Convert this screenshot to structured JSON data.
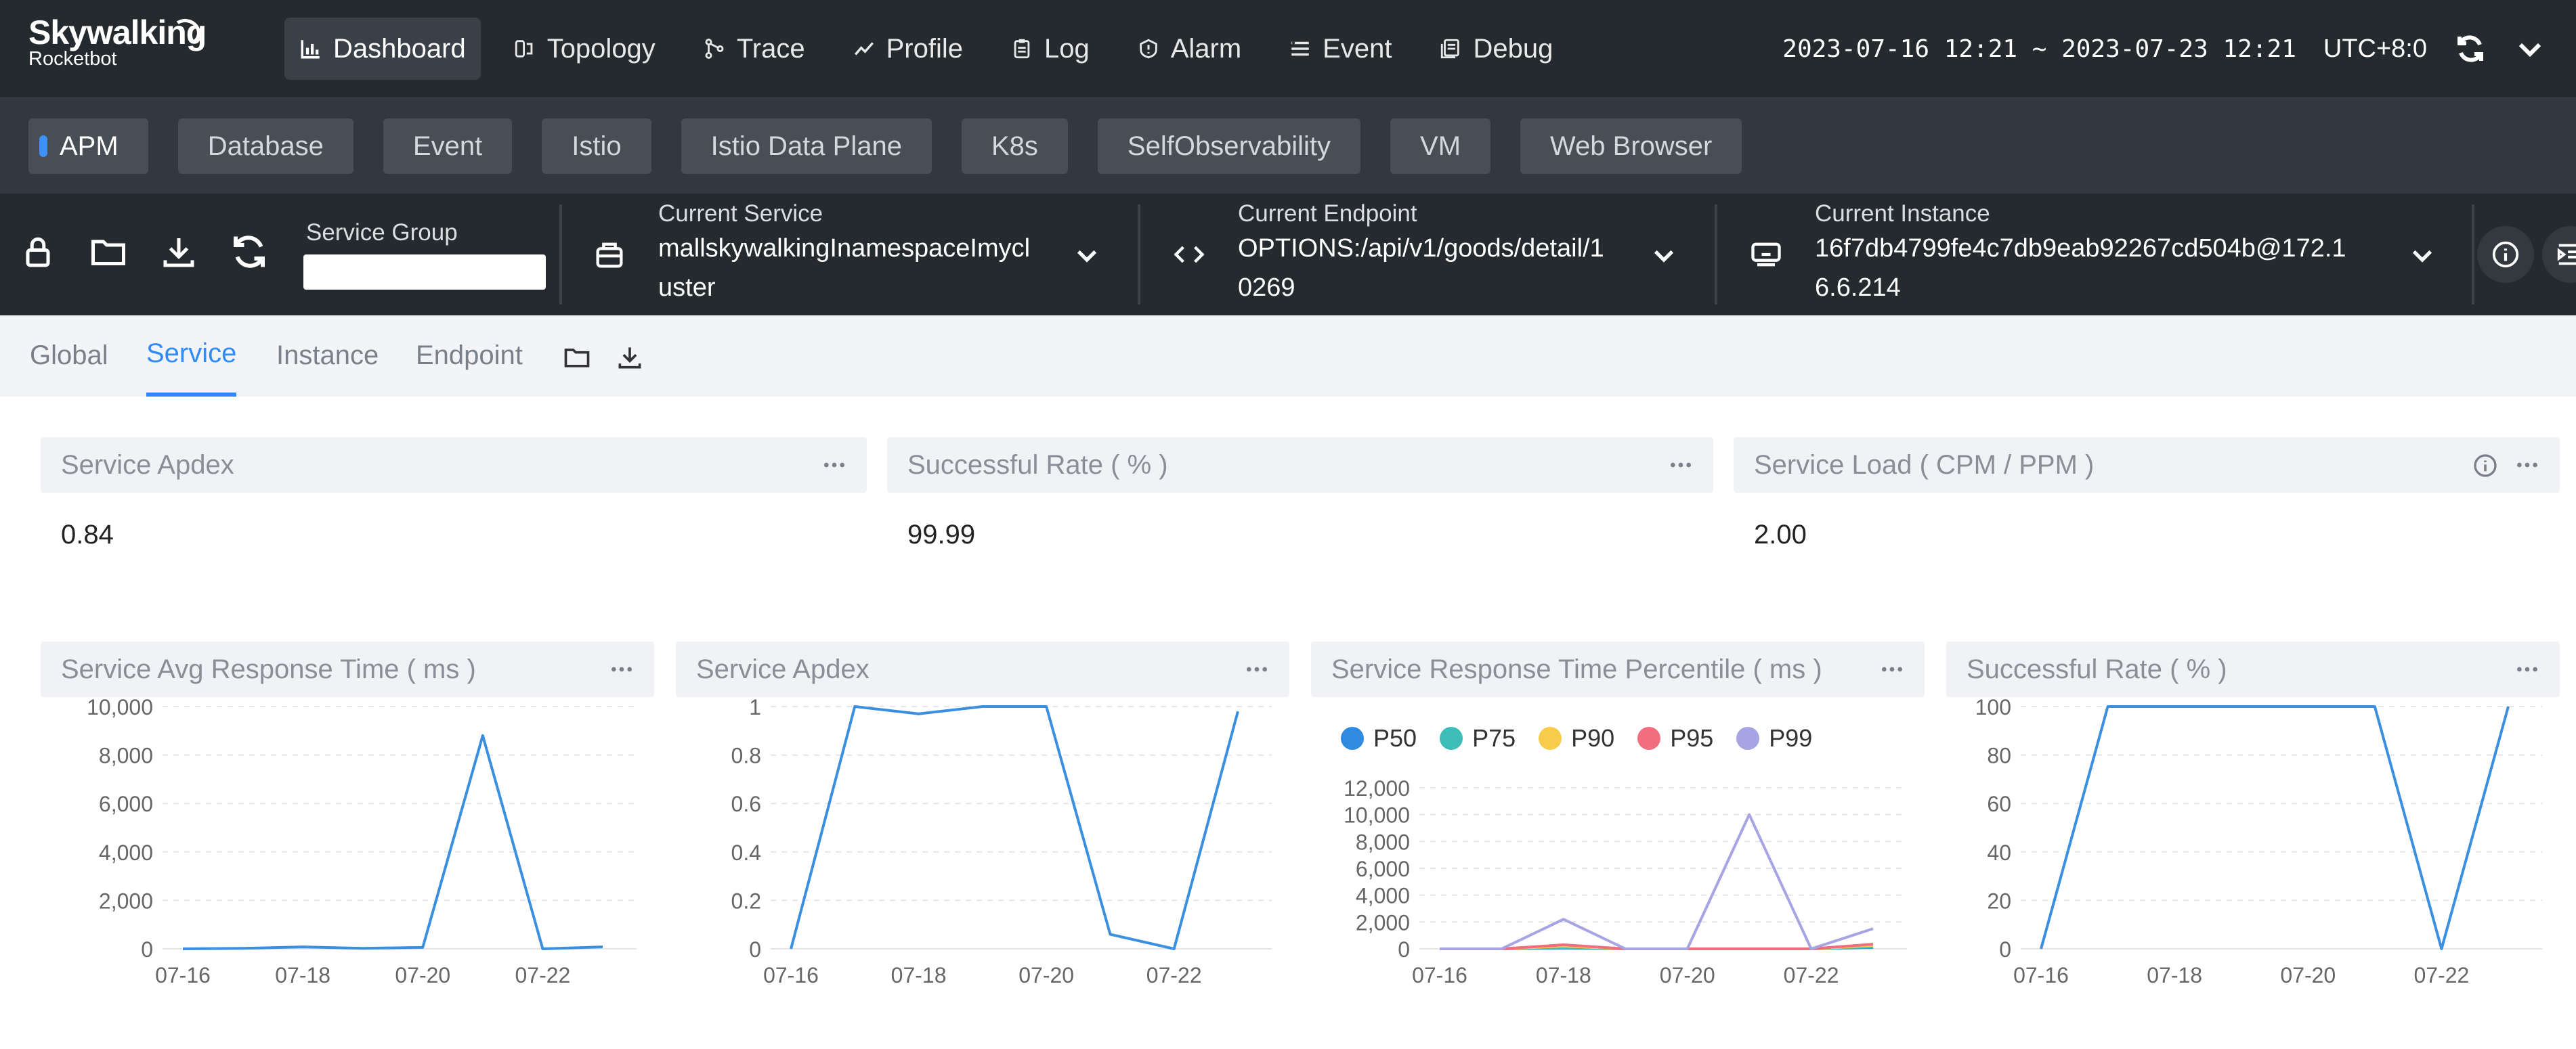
{
  "app": {
    "brand": "Skywalking",
    "subtitle": "Rocketbot"
  },
  "nav": [
    {
      "label": "Dashboard",
      "icon": "bar-chart-icon",
      "active": true
    },
    {
      "label": "Topology",
      "icon": "topology-icon",
      "active": false
    },
    {
      "label": "Trace",
      "icon": "trace-icon",
      "active": false
    },
    {
      "label": "Profile",
      "icon": "profile-icon",
      "active": false
    },
    {
      "label": "Log",
      "icon": "log-icon",
      "active": false
    },
    {
      "label": "Alarm",
      "icon": "alarm-icon",
      "active": false
    },
    {
      "label": "Event",
      "icon": "event-icon",
      "active": false
    },
    {
      "label": "Debug",
      "icon": "debug-icon",
      "active": false
    }
  ],
  "time": {
    "range": "2023-07-16 12:21 ~ 2023-07-23 12:21",
    "timezone": "UTC+8:0"
  },
  "layers": [
    {
      "label": "APM",
      "active": true
    },
    {
      "label": "Database",
      "active": false
    },
    {
      "label": "Event",
      "active": false
    },
    {
      "label": "Istio",
      "active": false
    },
    {
      "label": "Istio Data Plane",
      "active": false
    },
    {
      "label": "K8s",
      "active": false
    },
    {
      "label": "SelfObservability",
      "active": false
    },
    {
      "label": "VM",
      "active": false
    },
    {
      "label": "Web Browser",
      "active": false
    }
  ],
  "selectors": {
    "service_group": {
      "label": "Service Group",
      "value": ""
    },
    "service": {
      "label": "Current Service",
      "line1": "mallskywalkingInamespaceImycl",
      "line2": "uster"
    },
    "endpoint": {
      "label": "Current Endpoint",
      "line1": "OPTIONS:/api/v1/goods/detail/1",
      "line2": "0269"
    },
    "instance": {
      "label": "Current Instance",
      "line1": "16f7db4799fe4c7db9eab92267cd504b@172.1",
      "line2": "6.6.214"
    }
  },
  "dash_tabs": [
    {
      "label": "Global",
      "active": false
    },
    {
      "label": "Service",
      "active": true
    },
    {
      "label": "Instance",
      "active": false
    },
    {
      "label": "Endpoint",
      "active": false
    }
  ],
  "cards": [
    {
      "title": "Service Apdex",
      "value": "0.84"
    },
    {
      "title": "Successful Rate ( % )",
      "value": "99.99"
    },
    {
      "title": "Service Load ( CPM / PPM )",
      "value": "2.00"
    }
  ],
  "colors": {
    "accent": "#2f8bf5",
    "line": "#3b8fe0",
    "p50": "#2f8be0",
    "p75": "#3ebcb8",
    "p90": "#f7cc4a",
    "p95": "#f26d7d",
    "p99": "#a6a4e3"
  },
  "chart_data": [
    {
      "type": "line",
      "title": "Service Avg Response Time ( ms )",
      "x": [
        "07-16",
        "07-17",
        "07-18",
        "07-19",
        "07-20",
        "07-21",
        "07-22",
        "07-23"
      ],
      "xticks": [
        "07-16",
        "07-18",
        "07-20",
        "07-22"
      ],
      "ylim": [
        0,
        10000
      ],
      "yticks": [
        "0",
        "2,000",
        "4,000",
        "6,000",
        "8,000",
        "10,000"
      ],
      "series": [
        {
          "values": [
            0,
            20,
            80,
            20,
            60,
            8800,
            0,
            80
          ]
        }
      ]
    },
    {
      "type": "line",
      "title": "Service Apdex",
      "x": [
        "07-16",
        "07-17",
        "07-18",
        "07-19",
        "07-20",
        "07-21",
        "07-22",
        "07-23"
      ],
      "xticks": [
        "07-16",
        "07-18",
        "07-20",
        "07-22"
      ],
      "ylim": [
        0,
        1
      ],
      "yticks": [
        "0",
        "0.2",
        "0.4",
        "0.6",
        "0.8",
        "1"
      ],
      "series": [
        {
          "values": [
            0,
            1,
            0.97,
            1,
            1,
            0.06,
            0,
            0.98
          ]
        }
      ]
    },
    {
      "type": "line",
      "title": "Service Response Time Percentile ( ms )",
      "x": [
        "07-16",
        "07-17",
        "07-18",
        "07-19",
        "07-20",
        "07-21",
        "07-22",
        "07-23"
      ],
      "xticks": [
        "07-16",
        "07-18",
        "07-20",
        "07-22"
      ],
      "ylim": [
        0,
        12000
      ],
      "yticks": [
        "0",
        "2,000",
        "4,000",
        "6,000",
        "8,000",
        "10,000",
        "12,000"
      ],
      "legend": "top-left",
      "series": [
        {
          "name": "P50",
          "values": [
            0,
            0,
            50,
            0,
            0,
            0,
            0,
            100
          ]
        },
        {
          "name": "P75",
          "values": [
            0,
            0,
            100,
            0,
            0,
            0,
            0,
            150
          ]
        },
        {
          "name": "P90",
          "values": [
            0,
            0,
            200,
            0,
            0,
            0,
            0,
            250
          ]
        },
        {
          "name": "P95",
          "values": [
            0,
            0,
            300,
            0,
            0,
            0,
            0,
            350
          ]
        },
        {
          "name": "P99",
          "values": [
            0,
            0,
            2200,
            0,
            0,
            10000,
            0,
            1500
          ]
        }
      ]
    },
    {
      "type": "line",
      "title": "Successful Rate ( % )",
      "x": [
        "07-16",
        "07-17",
        "07-18",
        "07-19",
        "07-20",
        "07-21",
        "07-22",
        "07-23"
      ],
      "xticks": [
        "07-16",
        "07-18",
        "07-20",
        "07-22"
      ],
      "ylim": [
        0,
        100
      ],
      "yticks": [
        "0",
        "20",
        "40",
        "60",
        "80",
        "100"
      ],
      "series": [
        {
          "values": [
            0,
            100,
            100,
            100,
            100,
            100,
            0,
            100
          ]
        }
      ]
    }
  ]
}
